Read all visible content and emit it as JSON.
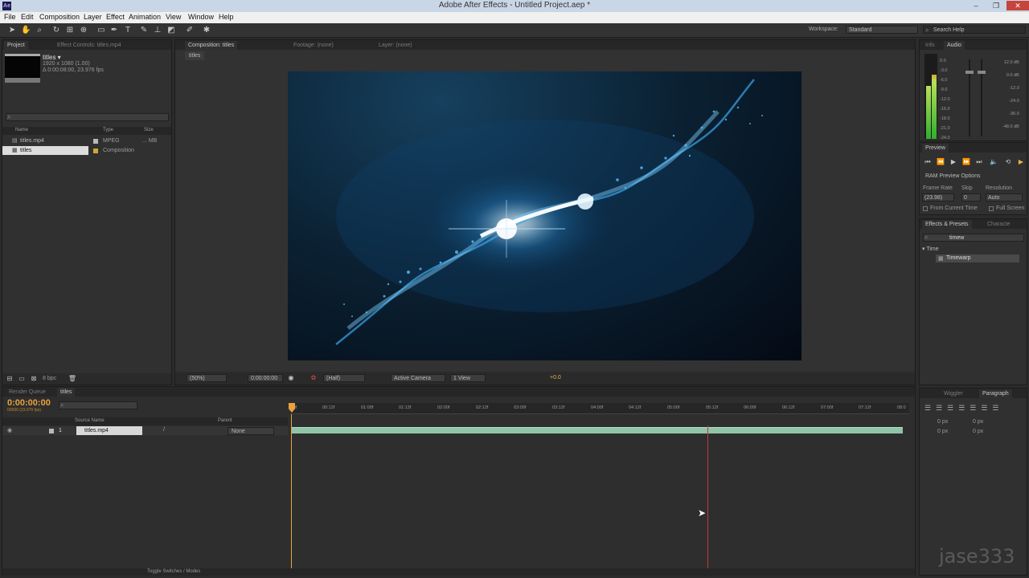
{
  "window": {
    "title": "Adobe After Effects - Untitled Project.aep *",
    "min": "–",
    "max": "❐",
    "close": "✕"
  },
  "menu": [
    "File",
    "Edit",
    "Composition",
    "Layer",
    "Effect",
    "Animation",
    "View",
    "Window",
    "Help"
  ],
  "toolbar": {
    "workspace_label": "Workspace:",
    "workspace_value": "Standard",
    "search_placeholder": "Search Help"
  },
  "project": {
    "tabs": [
      "Project",
      "Effect Controls: titles.mp4"
    ],
    "selected_name": "titles ▾",
    "selected_info1": "1920 x 1080 (1.00)",
    "selected_info2": "Δ 0:00:08:00, 23.976 fps",
    "columns": {
      "name": "Name",
      "type": "Type",
      "size": "Size"
    },
    "items": [
      {
        "name": "titles.mp4",
        "type": "MPEG",
        "size": "... MB"
      },
      {
        "name": "titles",
        "type": "Composition",
        "size": ""
      }
    ],
    "bpc": "8 bpc"
  },
  "composition": {
    "tabs": [
      "Composition: titles",
      "Footage: (none)",
      "Layer: (none)"
    ],
    "breadcrumb": "titles",
    "zoom": "(50%)",
    "timecode": "0:00:00:00",
    "resolution": "(Half)",
    "camera": "Active Camera",
    "view": "1 View",
    "exposure": "+0.0"
  },
  "info_audio": {
    "tabs": [
      "Info",
      "Audio"
    ],
    "left_scale": [
      "0.0",
      "-3.0",
      "-6.0",
      "-9.0",
      "-12.0",
      "-15.0",
      "-18.0",
      "-21.0",
      "-24.0"
    ],
    "right_scale": [
      "12.0 dB",
      "0.0 dB",
      "-12.0",
      "-24.0",
      "-36.0",
      "-48.0 dB"
    ]
  },
  "preview": {
    "tab": "Preview",
    "ram_options": "RAM Preview Options",
    "frame_rate_label": "Frame Rate",
    "skip_label": "Skip",
    "resolution_label": "Resolution",
    "frame_rate_value": "(23.98)",
    "skip_value": "0",
    "resolution_value": "Auto",
    "from_current": "From Current Time",
    "full_screen": "Full Screen"
  },
  "effects": {
    "tabs": [
      "Effects & Presets",
      "Characte"
    ],
    "search_value": "timew",
    "category": "▾ Time",
    "item": "Timewarp"
  },
  "timeline": {
    "tabs": [
      "Render Queue",
      "titles"
    ],
    "timecode": "0:00:00:00",
    "timecode_sub": "00000 (23.976 fps)",
    "columns": {
      "source": "Source Name",
      "parent": "Parent"
    },
    "layer": {
      "index": "1",
      "name": "titles.mp4",
      "parent": "None"
    },
    "ruler": [
      "0f",
      "00:12f",
      "01:00f",
      "01:12f",
      "02:00f",
      "02:12f",
      "03:00f",
      "03:12f",
      "04:00f",
      "04:12f",
      "05:00f",
      "05:12f",
      "06:00f",
      "06:12f",
      "07:00f",
      "07:12f",
      "08:0"
    ],
    "toggle_label": "Toggle Switches / Modes"
  },
  "paragraph": {
    "tabs": [
      "Wiggler",
      "Paragraph"
    ],
    "px_values": [
      "0 px",
      "0 px",
      "0 px",
      "0 px",
      "0 px"
    ]
  },
  "watermark": "jase333",
  "colors": {
    "accent": "#e8b04b",
    "timecode": "#e8a33d",
    "layer_bar": "#7fb89b",
    "meter_green": "#3cb83c"
  }
}
